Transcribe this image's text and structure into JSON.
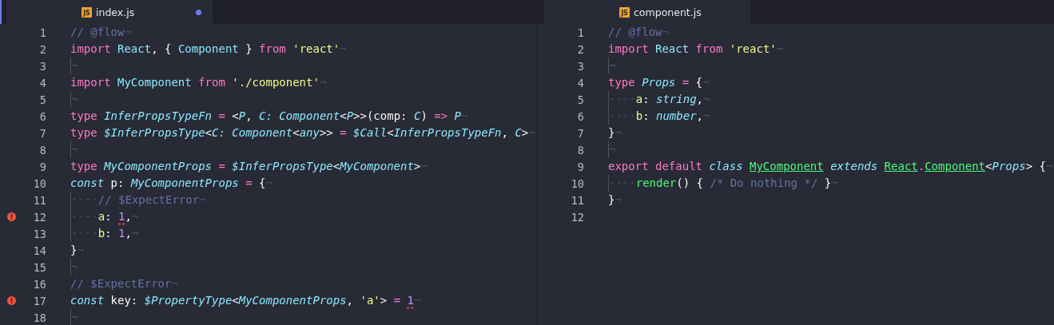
{
  "panes": [
    {
      "focused": true,
      "tab": {
        "icon_label": "JS",
        "label": "index.js",
        "modified": true,
        "selected": true
      },
      "lines": [
        {
          "number": "1",
          "error": false,
          "guide": false,
          "tokens": [
            {
              "kind": "cmt",
              "text": "// @flow"
            },
            {
              "kind": "inv",
              "text": "¬"
            }
          ]
        },
        {
          "number": "2",
          "error": false,
          "guide": false,
          "tokens": [
            {
              "kind": "kw",
              "text": "import "
            },
            {
              "kind": "id",
              "text": "React"
            },
            {
              "kind": "plain",
              "text": ", { "
            },
            {
              "kind": "id",
              "text": "Component"
            },
            {
              "kind": "plain",
              "text": " } "
            },
            {
              "kind": "kw",
              "text": "from "
            },
            {
              "kind": "str",
              "text": "'react'"
            },
            {
              "kind": "inv",
              "text": "¬"
            }
          ]
        },
        {
          "number": "3",
          "error": false,
          "guide": true,
          "tokens": [
            {
              "kind": "inv",
              "text": "¬"
            }
          ]
        },
        {
          "number": "4",
          "error": false,
          "guide": false,
          "tokens": [
            {
              "kind": "kw",
              "text": "import "
            },
            {
              "kind": "id",
              "text": "MyComponent "
            },
            {
              "kind": "kw",
              "text": "from "
            },
            {
              "kind": "str",
              "text": "'./component'"
            },
            {
              "kind": "inv",
              "text": "¬"
            }
          ]
        },
        {
          "number": "5",
          "error": false,
          "guide": true,
          "tokens": [
            {
              "kind": "inv",
              "text": "¬"
            }
          ]
        },
        {
          "number": "6",
          "error": false,
          "guide": false,
          "tokens": [
            {
              "kind": "kw",
              "text": "type "
            },
            {
              "kind": "type",
              "text": "InferPropsTypeFn "
            },
            {
              "kind": "op",
              "text": "= "
            },
            {
              "kind": "plain",
              "text": "<"
            },
            {
              "kind": "type",
              "text": "P"
            },
            {
              "kind": "plain",
              "text": ", "
            },
            {
              "kind": "type",
              "text": "C: Component"
            },
            {
              "kind": "plain",
              "text": "<"
            },
            {
              "kind": "type",
              "text": "P"
            },
            {
              "kind": "plain",
              "text": ">>(comp: "
            },
            {
              "kind": "type",
              "text": "C"
            },
            {
              "kind": "plain",
              "text": ") "
            },
            {
              "kind": "op",
              "text": "=> "
            },
            {
              "kind": "type",
              "text": "P"
            },
            {
              "kind": "inv",
              "text": "¬"
            }
          ]
        },
        {
          "number": "7",
          "error": false,
          "guide": false,
          "tokens": [
            {
              "kind": "kw",
              "text": "type "
            },
            {
              "kind": "type",
              "text": "$InferPropsType"
            },
            {
              "kind": "plain",
              "text": "<"
            },
            {
              "kind": "type",
              "text": "C: Component"
            },
            {
              "kind": "plain",
              "text": "<"
            },
            {
              "kind": "type",
              "text": "any"
            },
            {
              "kind": "plain",
              "text": ">> "
            },
            {
              "kind": "op",
              "text": "= "
            },
            {
              "kind": "type",
              "text": "$Call"
            },
            {
              "kind": "plain",
              "text": "<"
            },
            {
              "kind": "type",
              "text": "InferPropsTypeFn"
            },
            {
              "kind": "plain",
              "text": ", "
            },
            {
              "kind": "type",
              "text": "C"
            },
            {
              "kind": "plain",
              "text": ">"
            },
            {
              "kind": "inv",
              "text": "¬"
            }
          ]
        },
        {
          "number": "8",
          "error": false,
          "guide": true,
          "tokens": [
            {
              "kind": "inv",
              "text": "¬"
            }
          ]
        },
        {
          "number": "9",
          "error": false,
          "guide": false,
          "tokens": [
            {
              "kind": "kw",
              "text": "type "
            },
            {
              "kind": "type",
              "text": "MyComponentProps "
            },
            {
              "kind": "op",
              "text": "= "
            },
            {
              "kind": "type",
              "text": "$InferPropsType"
            },
            {
              "kind": "plain",
              "text": "<"
            },
            {
              "kind": "type",
              "text": "MyComponent"
            },
            {
              "kind": "plain",
              "text": ">"
            },
            {
              "kind": "inv",
              "text": "¬"
            }
          ]
        },
        {
          "number": "10",
          "error": false,
          "guide": false,
          "tokens": [
            {
              "kind": "type",
              "text": "const"
            },
            {
              "kind": "plain",
              "text": " p: "
            },
            {
              "kind": "type",
              "text": "MyComponentProps "
            },
            {
              "kind": "op",
              "text": "="
            },
            {
              "kind": "plain",
              "text": " {"
            },
            {
              "kind": "inv",
              "text": "¬"
            }
          ]
        },
        {
          "number": "11",
          "error": false,
          "guide": true,
          "tokens": [
            {
              "kind": "inv",
              "text": "····"
            },
            {
              "kind": "cmt",
              "text": "// $ExpectError"
            },
            {
              "kind": "inv",
              "text": "¬"
            }
          ]
        },
        {
          "number": "12",
          "error": true,
          "guide": true,
          "tokens": [
            {
              "kind": "inv",
              "text": "····"
            },
            {
              "kind": "prop",
              "text": "a"
            },
            {
              "kind": "plain",
              "text": ": "
            },
            {
              "kind": "errnum",
              "text": "1"
            },
            {
              "kind": "plain",
              "text": ","
            },
            {
              "kind": "inv",
              "text": "¬"
            }
          ]
        },
        {
          "number": "13",
          "error": false,
          "guide": true,
          "tokens": [
            {
              "kind": "inv",
              "text": "····"
            },
            {
              "kind": "prop",
              "text": "b"
            },
            {
              "kind": "plain",
              "text": ": "
            },
            {
              "kind": "num",
              "text": "1"
            },
            {
              "kind": "plain",
              "text": ","
            },
            {
              "kind": "inv",
              "text": "¬"
            }
          ]
        },
        {
          "number": "14",
          "error": false,
          "guide": false,
          "tokens": [
            {
              "kind": "plain",
              "text": "}"
            },
            {
              "kind": "inv",
              "text": "¬"
            }
          ]
        },
        {
          "number": "15",
          "error": false,
          "guide": true,
          "tokens": [
            {
              "kind": "inv",
              "text": "¬"
            }
          ]
        },
        {
          "number": "16",
          "error": false,
          "guide": false,
          "tokens": [
            {
              "kind": "cmt",
              "text": "// $ExpectError"
            },
            {
              "kind": "inv",
              "text": "¬"
            }
          ]
        },
        {
          "number": "17",
          "error": true,
          "guide": false,
          "tokens": [
            {
              "kind": "type",
              "text": "const"
            },
            {
              "kind": "plain",
              "text": " key: "
            },
            {
              "kind": "type",
              "text": "$PropertyType"
            },
            {
              "kind": "plain",
              "text": "<"
            },
            {
              "kind": "type",
              "text": "MyComponentProps"
            },
            {
              "kind": "plain",
              "text": ", "
            },
            {
              "kind": "str",
              "text": "'a'"
            },
            {
              "kind": "plain",
              "text": "> "
            },
            {
              "kind": "op",
              "text": "= "
            },
            {
              "kind": "errnum",
              "text": "1"
            },
            {
              "kind": "inv",
              "text": "¬"
            }
          ]
        },
        {
          "number": "18",
          "error": false,
          "guide": true,
          "tokens": [
            {
              "kind": "inv",
              "text": "¬"
            }
          ]
        }
      ]
    },
    {
      "focused": false,
      "tab": {
        "icon_label": "JS",
        "label": "component.js",
        "modified": false,
        "selected": true
      },
      "lines": [
        {
          "number": "1",
          "error": false,
          "guide": false,
          "tokens": [
            {
              "kind": "cmt",
              "text": "// @flow"
            },
            {
              "kind": "inv",
              "text": "¬"
            }
          ]
        },
        {
          "number": "2",
          "error": false,
          "guide": false,
          "tokens": [
            {
              "kind": "kw",
              "text": "import "
            },
            {
              "kind": "id",
              "text": "React "
            },
            {
              "kind": "kw",
              "text": "from "
            },
            {
              "kind": "str",
              "text": "'react'"
            },
            {
              "kind": "inv",
              "text": "¬"
            }
          ]
        },
        {
          "number": "3",
          "error": false,
          "guide": true,
          "tokens": [
            {
              "kind": "inv",
              "text": "¬"
            }
          ]
        },
        {
          "number": "4",
          "error": false,
          "guide": false,
          "tokens": [
            {
              "kind": "kw",
              "text": "type "
            },
            {
              "kind": "type",
              "text": "Props "
            },
            {
              "kind": "op",
              "text": "="
            },
            {
              "kind": "plain",
              "text": " {"
            },
            {
              "kind": "inv",
              "text": "¬"
            }
          ]
        },
        {
          "number": "5",
          "error": false,
          "guide": true,
          "tokens": [
            {
              "kind": "inv",
              "text": "····"
            },
            {
              "kind": "prop",
              "text": "a"
            },
            {
              "kind": "plain",
              "text": ": "
            },
            {
              "kind": "type",
              "text": "string"
            },
            {
              "kind": "plain",
              "text": ","
            },
            {
              "kind": "inv",
              "text": "¬"
            }
          ]
        },
        {
          "number": "6",
          "error": false,
          "guide": true,
          "tokens": [
            {
              "kind": "inv",
              "text": "····"
            },
            {
              "kind": "prop",
              "text": "b"
            },
            {
              "kind": "plain",
              "text": ": "
            },
            {
              "kind": "type",
              "text": "number"
            },
            {
              "kind": "plain",
              "text": ","
            },
            {
              "kind": "inv",
              "text": "¬"
            }
          ]
        },
        {
          "number": "7",
          "error": false,
          "guide": false,
          "tokens": [
            {
              "kind": "plain",
              "text": "}"
            },
            {
              "kind": "inv",
              "text": "¬"
            }
          ]
        },
        {
          "number": "8",
          "error": false,
          "guide": true,
          "tokens": [
            {
              "kind": "inv",
              "text": "¬"
            }
          ]
        },
        {
          "number": "9",
          "error": false,
          "guide": false,
          "tokens": [
            {
              "kind": "kw",
              "text": "export default "
            },
            {
              "kind": "type",
              "text": "class "
            },
            {
              "kind": "entity",
              "text": "MyComponent"
            },
            {
              "kind": "type",
              "text": " extends "
            },
            {
              "kind": "entity",
              "text": "React"
            },
            {
              "kind": "op",
              "text": "."
            },
            {
              "kind": "entity",
              "text": "Component"
            },
            {
              "kind": "plain",
              "text": "<"
            },
            {
              "kind": "type",
              "text": "Props"
            },
            {
              "kind": "plain",
              "text": "> {"
            },
            {
              "kind": "inv",
              "text": "¬"
            }
          ]
        },
        {
          "number": "10",
          "error": false,
          "guide": true,
          "tokens": [
            {
              "kind": "inv",
              "text": "····"
            },
            {
              "kind": "fn",
              "text": "render"
            },
            {
              "kind": "plain",
              "text": "() { "
            },
            {
              "kind": "cmt",
              "text": "/* Do nothing */"
            },
            {
              "kind": "plain",
              "text": " }"
            },
            {
              "kind": "inv",
              "text": "¬"
            }
          ]
        },
        {
          "number": "11",
          "error": false,
          "guide": false,
          "tokens": [
            {
              "kind": "plain",
              "text": "}"
            },
            {
              "kind": "inv",
              "text": "¬"
            }
          ]
        },
        {
          "number": "12",
          "error": false
        }
      ]
    }
  ]
}
